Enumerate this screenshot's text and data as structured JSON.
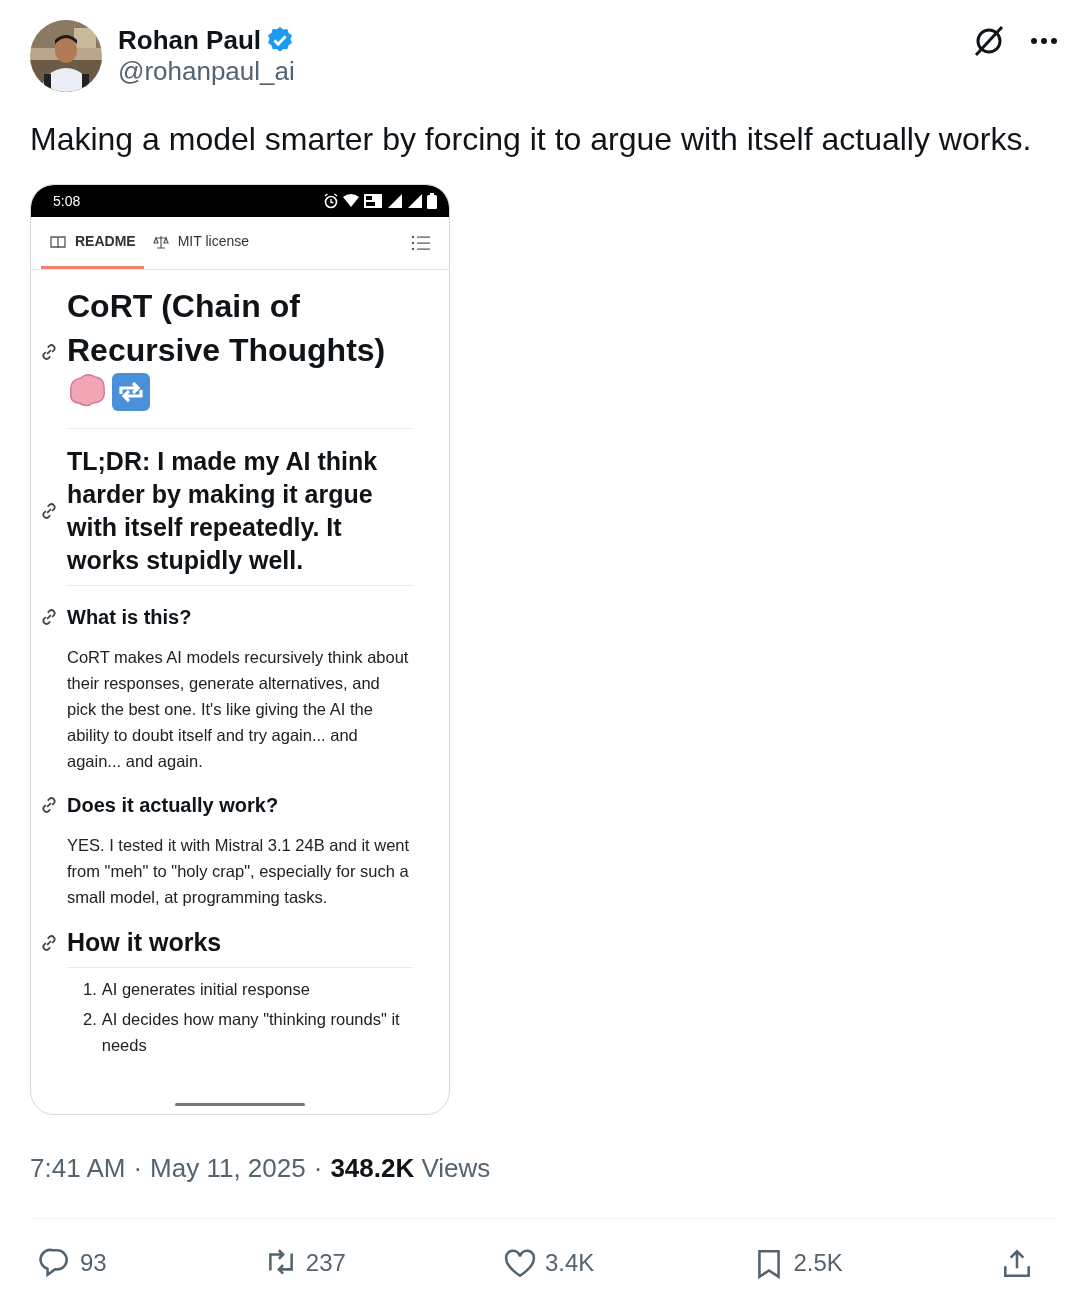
{
  "author": {
    "name": "Rohan Paul",
    "verified": true,
    "handle": "@rohanpaul_ai"
  },
  "tweet_text": "Making a model smarter by forcing it to argue with itself actually works.",
  "phone": {
    "status_time": "5:08",
    "tabs": [
      {
        "label": "README",
        "kind": "book",
        "selected": true
      },
      {
        "label": "MIT license",
        "kind": "scale",
        "selected": false
      }
    ],
    "content": [
      {
        "kind": "h1",
        "text": "CoRT (Chain of Recursive Thoughts)"
      },
      {
        "kind": "h2",
        "text": "TL;DR: I made my AI think harder by making it argue with itself repeatedly. It works stupidly well."
      },
      {
        "kind": "h3",
        "text": "What is this?"
      },
      {
        "kind": "p",
        "text": "CoRT makes AI models recursively think about their responses, generate alternatives, and pick the best one. It's like giving the AI the ability to doubt itself and try again... and again... and again."
      },
      {
        "kind": "h3",
        "text": "Does it actually work?"
      },
      {
        "kind": "p",
        "text": "YES. I tested it with Mistral 3.1 24B and it went from \"meh\" to \"holy crap\", especially for such a small model, at programming tasks."
      },
      {
        "kind": "h2",
        "text": "How it works"
      },
      {
        "kind": "ol",
        "items": [
          {
            "number": "1.",
            "text": "AI generates initial response"
          },
          {
            "number": "2.",
            "text": "AI decides how many \"thinking rounds\" it needs"
          }
        ]
      }
    ]
  },
  "meta": {
    "time": "7:41 AM",
    "separator": "·",
    "date": "May 11, 2025",
    "separator_2": "·",
    "views": "348.2K",
    "views_label": "Views"
  },
  "actions": [
    {
      "kind": "reply",
      "count": "93"
    },
    {
      "kind": "repost",
      "count": "237"
    },
    {
      "kind": "like",
      "count": "3.4K"
    },
    {
      "kind": "bookmark",
      "count": "2.5K"
    },
    {
      "kind": "share"
    }
  ]
}
